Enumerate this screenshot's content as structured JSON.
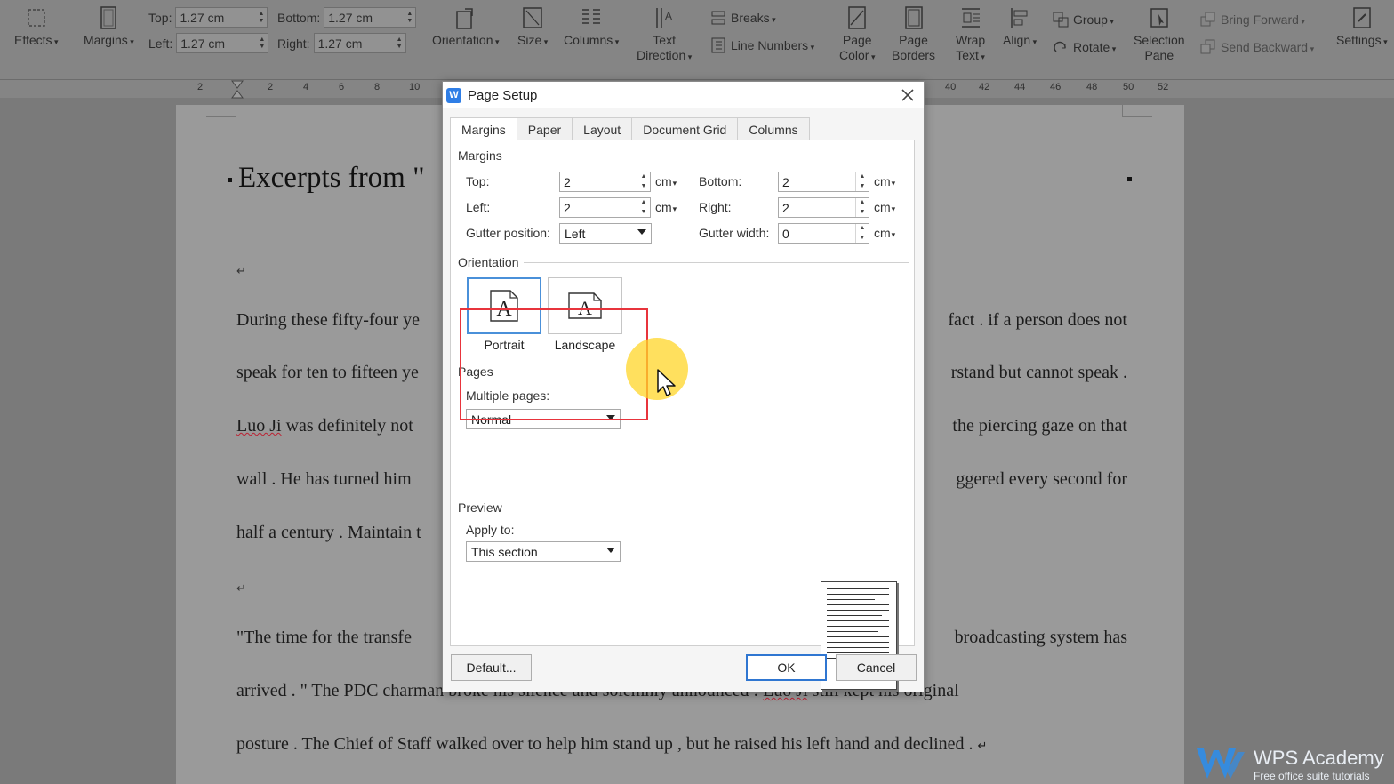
{
  "ribbon": {
    "effects": "Effects",
    "margins": "Margins",
    "margin_fields": {
      "top_label": "Top:",
      "top_value": "1.27 cm",
      "bottom_label": "Bottom:",
      "bottom_value": "1.27 cm",
      "left_label": "Left:",
      "left_value": "1.27 cm",
      "right_label": "Right:",
      "right_value": "1.27 cm"
    },
    "orientation": "Orientation",
    "size": "Size",
    "columns": "Columns",
    "text_direction_1": "Text",
    "text_direction_2": "Direction",
    "breaks": "Breaks",
    "line_numbers": "Line Numbers",
    "page_color_1": "Page",
    "page_color_2": "Color",
    "page_borders_1": "Page",
    "page_borders_2": "Borders",
    "wrap_text_1": "Wrap",
    "wrap_text_2": "Text",
    "align": "Align",
    "group": "Group",
    "rotate": "Rotate",
    "selection_pane_1": "Selection",
    "selection_pane_2": "Pane",
    "bring_forward": "Bring Forward",
    "send_backward": "Send Backward",
    "settings": "Settings"
  },
  "ruler": {
    "left_numbers": [
      "2",
      "2",
      "4",
      "6",
      "8",
      "10"
    ],
    "right_numbers": [
      "40",
      "42",
      "44",
      "46",
      "48",
      "50",
      "52"
    ]
  },
  "document": {
    "title": "Excerpts from \"",
    "lines": [
      {
        "left": "During these fifty-four ye",
        "right": "fact . if a person does not"
      },
      {
        "left": "speak for ten to fifteen ye",
        "right": "rstand but cannot speak ."
      },
      {
        "left_name": "Luo Ji",
        "left": " was definitely not",
        "right": "the piercing gaze on that"
      },
      {
        "left": "wall . He has turned him",
        "right": "ggered every second for"
      },
      {
        "left": "half a century . Maintain t",
        "right": ""
      },
      {
        "left": "\"The time for the transfe",
        "right": "broadcasting system has"
      }
    ],
    "line7_left": "arrived . \" The PDC cha",
    "line7_mid": "rman broke his silence and solemnly announced : ",
    "line7_name": "Luo Ji",
    "line7_right": " still kept his original",
    "line8": "posture . The Chief of Staff walked over to help him stand up , but he raised his left hand and declined ."
  },
  "dialog": {
    "title": "Page Setup",
    "tabs": [
      "Margins",
      "Paper",
      "Layout",
      "Document Grid",
      "Columns"
    ],
    "margins_section": "Margins",
    "top_label": "Top:",
    "top_value": "2",
    "bottom_label": "Bottom:",
    "bottom_value": "2",
    "left_label": "Left:",
    "left_value": "2",
    "right_label": "Right:",
    "right_value": "2",
    "unit": "cm",
    "gutter_position_label": "Gutter position:",
    "gutter_position_value": "Left",
    "gutter_width_label": "Gutter width:",
    "gutter_width_value": "0",
    "orientation_section": "Orientation",
    "portrait_label": "Portrait",
    "landscape_label": "Landscape",
    "selected_orientation": "Portrait",
    "pages_section": "Pages",
    "multiple_pages_label": "Multiple pages:",
    "multiple_pages_value": "Normal",
    "preview_section": "Preview",
    "apply_to_label": "Apply to:",
    "apply_to_value": "This section",
    "default_button": "Default...",
    "ok_button": "OK",
    "cancel_button": "Cancel"
  },
  "watermark": {
    "name": "WPS Academy",
    "tagline": "Free office suite tutorials"
  },
  "colors": {
    "highlight_box": "#e8343c",
    "cursor_halo": "#ffd628",
    "accent": "#2f76d1"
  }
}
